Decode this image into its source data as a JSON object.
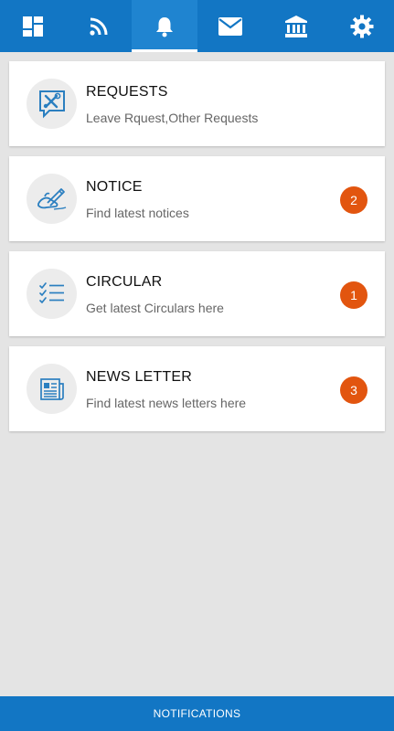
{
  "colors": {
    "primary": "#1276c4",
    "badge": "#e2550f",
    "icon_accent": "#2b7fc0"
  },
  "tabs": [
    {
      "icon": "dashboard-icon",
      "active": false
    },
    {
      "icon": "rss-feed-icon",
      "active": false
    },
    {
      "icon": "bell-icon",
      "active": true
    },
    {
      "icon": "mail-icon",
      "active": false
    },
    {
      "icon": "bank-icon",
      "active": false
    },
    {
      "icon": "gear-icon",
      "active": false
    }
  ],
  "items": [
    {
      "title": "REQUESTS",
      "subtitle": "Leave Rquest,Other Requests",
      "icon": "tools-chat-icon",
      "badge": ""
    },
    {
      "title": "NOTICE",
      "subtitle": "Find latest notices",
      "icon": "pen-hand-icon",
      "badge": "2"
    },
    {
      "title": "CIRCULAR",
      "subtitle": "Get latest Circulars here",
      "icon": "checklist-icon",
      "badge": "1"
    },
    {
      "title": "NEWS LETTER",
      "subtitle": "Find latest news letters here",
      "icon": "newspaper-icon",
      "badge": "3"
    }
  ],
  "footer": {
    "label": "NOTIFICATIONS"
  }
}
